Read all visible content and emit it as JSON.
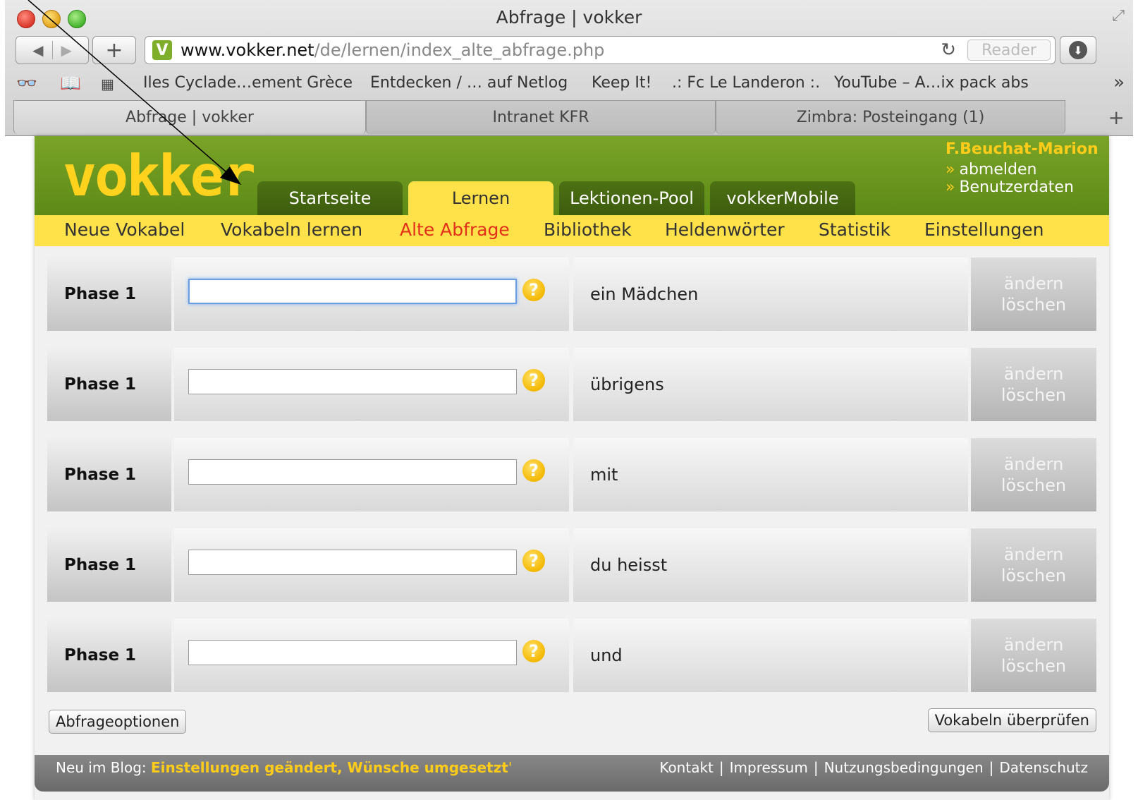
{
  "window": {
    "title": "Abfrage | vokker"
  },
  "toolbar": {
    "back_icon": "◀",
    "forward_icon": "▶",
    "new_tab_icon": "+",
    "url_host": "www.vokker.net",
    "url_path": "/de/lernen/index_alte_abfrage.php",
    "reload_icon": "↻",
    "reader_label": "Reader",
    "favicon_letter": "V"
  },
  "bookmarks": {
    "items": [
      "Iles Cyclade…ement Grèce",
      "Entdecken / … auf Netlog",
      "Keep It!",
      ".: Fc Le Landeron :.",
      "YouTube – A…ix pack abs"
    ],
    "more_icon": "»"
  },
  "browser_tabs": [
    {
      "label": "Abfrage | vokker",
      "active": true
    },
    {
      "label": "Intranet KFR",
      "active": false
    },
    {
      "label": "Zimbra: Posteingang (1)",
      "active": false
    }
  ],
  "site": {
    "logo": "vokker",
    "main_tabs": [
      "Startseite",
      "Lernen",
      "Lektionen-Pool",
      "vokkerMobile"
    ],
    "active_main_tab": "Lernen",
    "user": {
      "name": "F.Beuchat-Marion",
      "links": [
        "abmelden",
        "Benutzerdaten"
      ]
    },
    "subnav": [
      "Neue Vokabel",
      "Vokabeln lernen",
      "Alte Abfrage",
      "Bibliothek",
      "Heldenwörter",
      "Statistik",
      "Einstellungen"
    ],
    "active_subnav": "Alte Abfrage"
  },
  "rows": [
    {
      "phase": "Phase 1",
      "word": "ein Mädchen",
      "edit": "ändern",
      "delete": "löschen",
      "help": "?"
    },
    {
      "phase": "Phase 1",
      "word": "übrigens",
      "edit": "ändern",
      "delete": "löschen",
      "help": "?"
    },
    {
      "phase": "Phase 1",
      "word": "mit",
      "edit": "ändern",
      "delete": "löschen",
      "help": "?"
    },
    {
      "phase": "Phase 1",
      "word": "du heisst",
      "edit": "ändern",
      "delete": "löschen",
      "help": "?"
    },
    {
      "phase": "Phase 1",
      "word": "und",
      "edit": "ändern",
      "delete": "löschen",
      "help": "?"
    }
  ],
  "buttons": {
    "options": "Abfrageoptionen",
    "check": "Vokabeln überprüfen"
  },
  "footer": {
    "blog_prefix": "Neu im Blog:",
    "blog_link": "Einstellungen geändert, Wünsche umgesetzt",
    "blog_suffix": "'",
    "links": [
      "Kontakt",
      "Impressum",
      "Nutzungsbedingungen",
      "Datenschutz"
    ]
  },
  "colors": {
    "header_green": "#6b9620",
    "subnav_yellow": "#ffe14a",
    "logo_yellow": "#ffd21e",
    "active_red": "#e2301a"
  }
}
